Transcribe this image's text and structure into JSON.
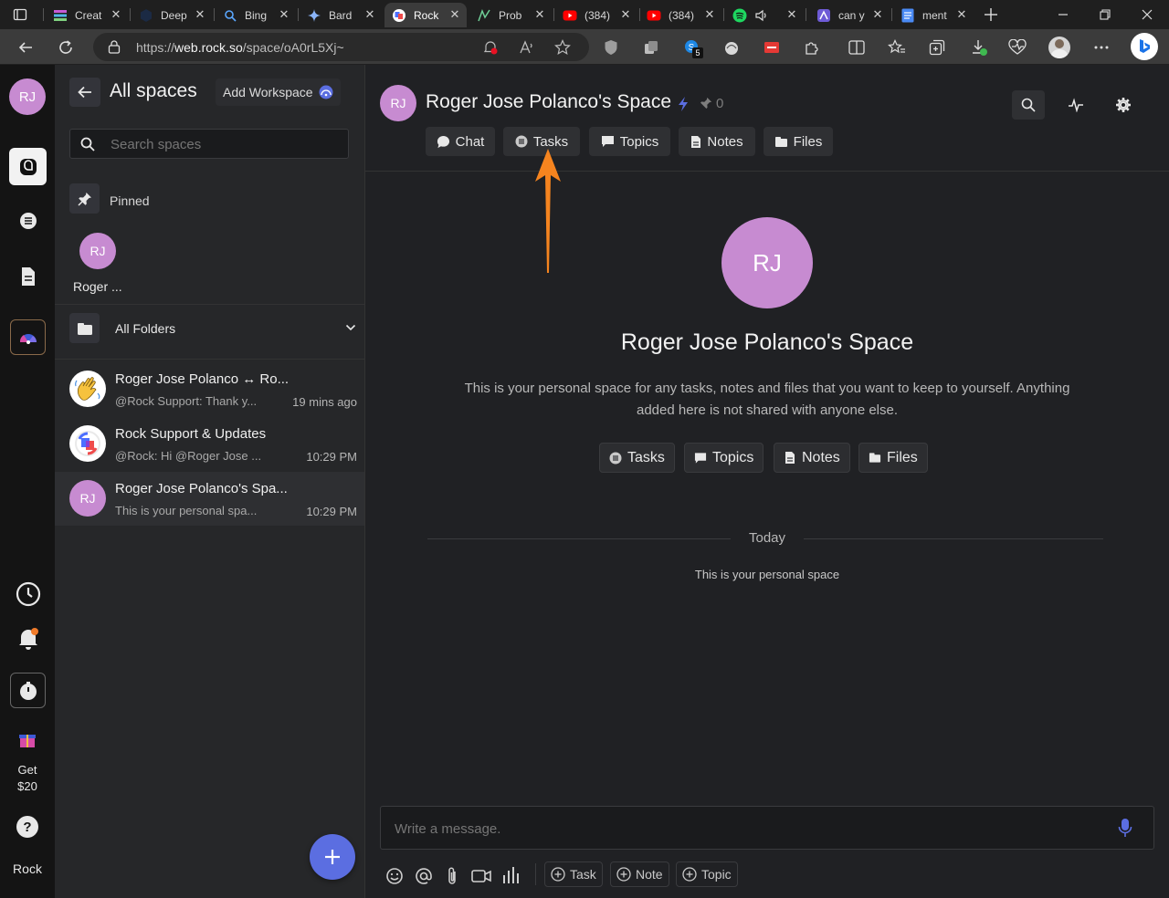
{
  "browser": {
    "tabs": [
      {
        "label": "Creat",
        "icon": "stacked-bars-icon"
      },
      {
        "label": "Deep",
        "icon": "deepl-icon"
      },
      {
        "label": "Bing",
        "icon": "search-icon"
      },
      {
        "label": "Bard",
        "icon": "sparkle-icon"
      },
      {
        "label": "Rock",
        "icon": "rock-logo-icon"
      },
      {
        "label": "Prob",
        "icon": "probability-icon"
      },
      {
        "label": "(384)",
        "icon": "youtube-icon"
      },
      {
        "label": "(384)",
        "icon": "youtube-icon"
      },
      {
        "label": "",
        "icon": "spotify-icon"
      },
      {
        "label": "can y",
        "icon": "app-icon"
      },
      {
        "label": "ment",
        "icon": "docs-icon"
      }
    ],
    "url_prefix": "https://",
    "url_host": "web.rock.so",
    "url_path": "/space/oA0rL5Xj~",
    "extension_badge": "5"
  },
  "rail": {
    "user_initials": "RJ",
    "get_line1": "Get",
    "get_line2": "$20",
    "brand": "Rock"
  },
  "panel": {
    "title": "All spaces",
    "add_workspace": "Add Workspace",
    "search_placeholder": "Search spaces",
    "pinned_label": "Pinned",
    "pinned_item_initials": "RJ",
    "pinned_item_name": "Roger ...",
    "folders_label": "All Folders",
    "conversations": [
      {
        "name": "Roger Jose Polanco ↔ Ro...",
        "preview": "@Rock Support: Thank y...",
        "time": "19 mins ago"
      },
      {
        "name": "Rock Support & Updates",
        "preview": "@Rock: Hi @Roger Jose ...",
        "time": "10:29 PM"
      },
      {
        "name": "Roger Jose Polanco's Spa...",
        "preview": "This is your personal spa...",
        "time": "10:29 PM",
        "initials": "RJ"
      }
    ]
  },
  "space": {
    "initials": "RJ",
    "title": "Roger Jose Polanco's Space",
    "pin_count": "0",
    "tabs": [
      "Chat",
      "Tasks",
      "Topics",
      "Notes",
      "Files"
    ],
    "hero_initials": "RJ",
    "hero_title": "Roger Jose Polanco's Space",
    "hero_desc_1": "This is your personal space for any tasks, notes and files that you want to keep to yourself. Anything",
    "hero_desc_2": "added here is not shared with anyone else.",
    "quick": [
      "Tasks",
      "Topics",
      "Notes",
      "Files"
    ],
    "divider_label": "Today",
    "system_message": "This is your personal space",
    "composer_placeholder": "Write a message.",
    "composer_actions": [
      "Task",
      "Note",
      "Topic"
    ]
  },
  "colors": {
    "accent": "#5b6ee1",
    "avatar": "#c78bd1",
    "arrow": "#f5841f"
  }
}
